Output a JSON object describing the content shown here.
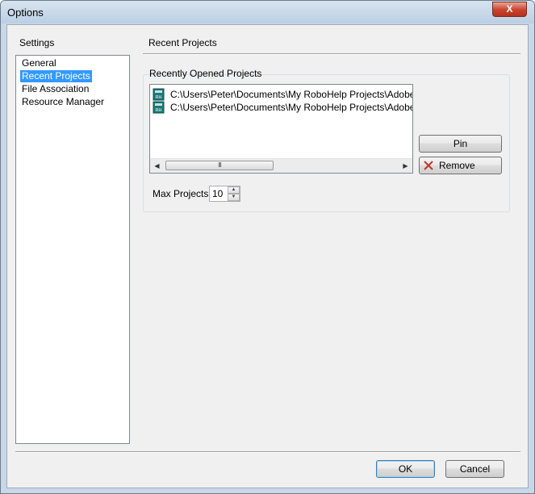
{
  "window": {
    "title": "Options",
    "close_glyph": "X"
  },
  "sidebar": {
    "heading": "Settings",
    "items": [
      {
        "label": "General",
        "selected": false
      },
      {
        "label": "Recent Projects",
        "selected": true
      },
      {
        "label": "File Association",
        "selected": false
      },
      {
        "label": "Resource Manager",
        "selected": false
      }
    ]
  },
  "panel": {
    "title": "Recent Projects",
    "group_label": "Recently Opened Projects",
    "projects": [
      {
        "path": "C:\\Users\\Peter\\Documents\\My RoboHelp Projects\\Adobe Rob",
        "icon": "robohelp-project-icon",
        "icon_text": "RH"
      },
      {
        "path": "C:\\Users\\Peter\\Documents\\My RoboHelp Projects\\Adobe Rob",
        "icon": "robohelp-project-icon",
        "icon_text": "RH"
      }
    ],
    "scroll_thumb_glyph": "III",
    "pin_label": "Pin",
    "remove_label": "Remove",
    "max_projects_label": "Max Projects:",
    "max_projects_value": "10"
  },
  "footer": {
    "ok_label": "OK",
    "cancel_label": "Cancel"
  },
  "colors": {
    "selection": "#3399ff",
    "close_button": "#c9412c",
    "icon_teal": "#1e7a78",
    "remove_x": "#c0392b"
  }
}
